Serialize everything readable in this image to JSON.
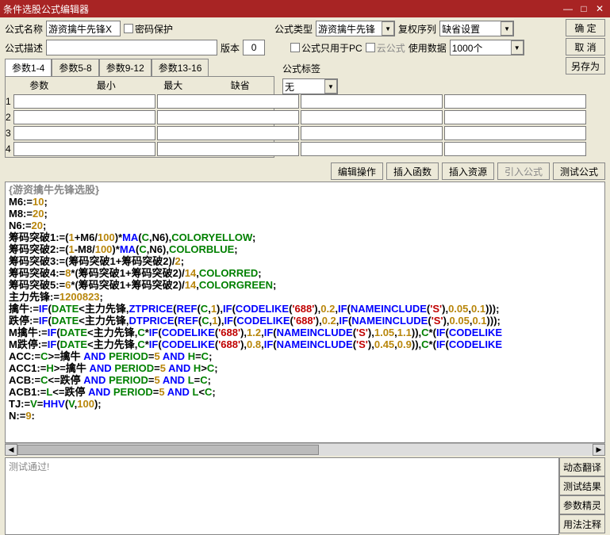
{
  "title": "条件选股公式编辑器",
  "labels": {
    "formula_name": "公式名称",
    "pwd_protect": "密码保护",
    "formula_type": "公式类型",
    "reset_seq": "复权序列",
    "formula_desc": "公式描述",
    "version": "版本",
    "pc_only": "公式只用于PC",
    "cloud_formula": "云公式",
    "use_data": "使用数据",
    "formula_tag": "公式标签",
    "ok": "确 定",
    "cancel": "取 消",
    "save_as": "另存为"
  },
  "values": {
    "formula_name": "游资擒牛先锋X",
    "formula_type": "游资擒牛先锋",
    "reset_seq": "缺省设置",
    "version": "0",
    "use_data": "1000个",
    "formula_tag": "无"
  },
  "param_tabs": [
    "参数1-4",
    "参数5-8",
    "参数9-12",
    "参数13-16"
  ],
  "param_headers": [
    "参数",
    "最小",
    "最大",
    "缺省"
  ],
  "action_buttons": {
    "edit_op": "编辑操作",
    "insert_fn": "插入函数",
    "insert_res": "插入资源",
    "import_formula": "引入公式",
    "test_formula": "测试公式"
  },
  "code_lines": [
    {
      "segs": [
        {
          "c": "gray",
          "t": "{游资擒牛先锋选股}"
        }
      ]
    },
    {
      "segs": [
        {
          "c": "black",
          "t": "M6:="
        },
        {
          "c": "brown",
          "t": "10"
        },
        {
          "c": "black",
          "t": ";"
        }
      ]
    },
    {
      "segs": [
        {
          "c": "black",
          "t": "M8:="
        },
        {
          "c": "brown",
          "t": "20"
        },
        {
          "c": "black",
          "t": ";"
        }
      ]
    },
    {
      "segs": [
        {
          "c": "black",
          "t": "N6:="
        },
        {
          "c": "brown",
          "t": "20"
        },
        {
          "c": "black",
          "t": ";"
        }
      ]
    },
    {
      "segs": [
        {
          "c": "black",
          "t": "筹码突破1:=("
        },
        {
          "c": "brown",
          "t": "1"
        },
        {
          "c": "black",
          "t": "+M6/"
        },
        {
          "c": "brown",
          "t": "100"
        },
        {
          "c": "black",
          "t": ")*"
        },
        {
          "c": "blue",
          "t": "MA"
        },
        {
          "c": "black",
          "t": "("
        },
        {
          "c": "green",
          "t": "C"
        },
        {
          "c": "black",
          "t": ",N6),"
        },
        {
          "c": "green",
          "t": "COLORYELLOW"
        },
        {
          "c": "black",
          "t": ";"
        }
      ]
    },
    {
      "segs": [
        {
          "c": "black",
          "t": "筹码突破2:=("
        },
        {
          "c": "brown",
          "t": "1"
        },
        {
          "c": "black",
          "t": "-M8/"
        },
        {
          "c": "brown",
          "t": "100"
        },
        {
          "c": "black",
          "t": ")*"
        },
        {
          "c": "blue",
          "t": "MA"
        },
        {
          "c": "black",
          "t": "("
        },
        {
          "c": "green",
          "t": "C"
        },
        {
          "c": "black",
          "t": ",N6),"
        },
        {
          "c": "green",
          "t": "COLORBLUE"
        },
        {
          "c": "black",
          "t": ";"
        }
      ]
    },
    {
      "segs": [
        {
          "c": "black",
          "t": "筹码突破3:=(筹码突破1+筹码突破2)/"
        },
        {
          "c": "brown",
          "t": "2"
        },
        {
          "c": "black",
          "t": ";"
        }
      ]
    },
    {
      "segs": [
        {
          "c": "black",
          "t": "筹码突破4:="
        },
        {
          "c": "brown",
          "t": "8"
        },
        {
          "c": "black",
          "t": "*(筹码突破1+筹码突破2)/"
        },
        {
          "c": "brown",
          "t": "14"
        },
        {
          "c": "black",
          "t": ","
        },
        {
          "c": "green",
          "t": "COLORRED"
        },
        {
          "c": "black",
          "t": ";"
        }
      ]
    },
    {
      "segs": [
        {
          "c": "black",
          "t": "筹码突破5:="
        },
        {
          "c": "brown",
          "t": "6"
        },
        {
          "c": "black",
          "t": "*(筹码突破1+筹码突破2)/"
        },
        {
          "c": "brown",
          "t": "14"
        },
        {
          "c": "black",
          "t": ","
        },
        {
          "c": "green",
          "t": "COLORGREEN"
        },
        {
          "c": "black",
          "t": ";"
        }
      ]
    },
    {
      "segs": [
        {
          "c": "black",
          "t": "主力先锋:="
        },
        {
          "c": "brown",
          "t": "1200823"
        },
        {
          "c": "black",
          "t": ";"
        }
      ]
    },
    {
      "segs": [
        {
          "c": "black",
          "t": "擒牛:="
        },
        {
          "c": "blue",
          "t": "IF"
        },
        {
          "c": "black",
          "t": "("
        },
        {
          "c": "green",
          "t": "DATE"
        },
        {
          "c": "black",
          "t": "<主力先锋,"
        },
        {
          "c": "blue",
          "t": "ZTPRICE"
        },
        {
          "c": "black",
          "t": "("
        },
        {
          "c": "blue",
          "t": "REF"
        },
        {
          "c": "black",
          "t": "("
        },
        {
          "c": "green",
          "t": "C"
        },
        {
          "c": "black",
          "t": ","
        },
        {
          "c": "brown",
          "t": "1"
        },
        {
          "c": "black",
          "t": "),"
        },
        {
          "c": "blue",
          "t": "IF"
        },
        {
          "c": "black",
          "t": "("
        },
        {
          "c": "blue",
          "t": "CODELIKE"
        },
        {
          "c": "black",
          "t": "("
        },
        {
          "c": "red",
          "t": "'688'"
        },
        {
          "c": "black",
          "t": "),"
        },
        {
          "c": "brown",
          "t": "0.2"
        },
        {
          "c": "black",
          "t": ","
        },
        {
          "c": "blue",
          "t": "IF"
        },
        {
          "c": "black",
          "t": "("
        },
        {
          "c": "blue",
          "t": "NAMEINCLUDE"
        },
        {
          "c": "black",
          "t": "("
        },
        {
          "c": "red",
          "t": "'S'"
        },
        {
          "c": "black",
          "t": "),"
        },
        {
          "c": "brown",
          "t": "0.05"
        },
        {
          "c": "black",
          "t": ","
        },
        {
          "c": "brown",
          "t": "0.1"
        },
        {
          "c": "black",
          "t": ")));"
        }
      ]
    },
    {
      "segs": [
        {
          "c": "black",
          "t": "跌停:="
        },
        {
          "c": "blue",
          "t": "IF"
        },
        {
          "c": "black",
          "t": "("
        },
        {
          "c": "green",
          "t": "DATE"
        },
        {
          "c": "black",
          "t": "<主力先锋,"
        },
        {
          "c": "blue",
          "t": "DTPRICE"
        },
        {
          "c": "black",
          "t": "("
        },
        {
          "c": "blue",
          "t": "REF"
        },
        {
          "c": "black",
          "t": "("
        },
        {
          "c": "green",
          "t": "C"
        },
        {
          "c": "black",
          "t": ","
        },
        {
          "c": "brown",
          "t": "1"
        },
        {
          "c": "black",
          "t": "),"
        },
        {
          "c": "blue",
          "t": "IF"
        },
        {
          "c": "black",
          "t": "("
        },
        {
          "c": "blue",
          "t": "CODELIKE"
        },
        {
          "c": "black",
          "t": "("
        },
        {
          "c": "red",
          "t": "'688'"
        },
        {
          "c": "black",
          "t": "),"
        },
        {
          "c": "brown",
          "t": "0.2"
        },
        {
          "c": "black",
          "t": ","
        },
        {
          "c": "blue",
          "t": "IF"
        },
        {
          "c": "black",
          "t": "("
        },
        {
          "c": "blue",
          "t": "NAMEINCLUDE"
        },
        {
          "c": "black",
          "t": "("
        },
        {
          "c": "red",
          "t": "'S'"
        },
        {
          "c": "black",
          "t": "),"
        },
        {
          "c": "brown",
          "t": "0.05"
        },
        {
          "c": "black",
          "t": ","
        },
        {
          "c": "brown",
          "t": "0.1"
        },
        {
          "c": "black",
          "t": ")));"
        }
      ]
    },
    {
      "segs": [
        {
          "c": "black",
          "t": "M擒牛:="
        },
        {
          "c": "blue",
          "t": "IF"
        },
        {
          "c": "black",
          "t": "("
        },
        {
          "c": "green",
          "t": "DATE"
        },
        {
          "c": "black",
          "t": "<主力先锋,"
        },
        {
          "c": "green",
          "t": "C"
        },
        {
          "c": "black",
          "t": "*"
        },
        {
          "c": "blue",
          "t": "IF"
        },
        {
          "c": "black",
          "t": "("
        },
        {
          "c": "blue",
          "t": "CODELIKE"
        },
        {
          "c": "black",
          "t": "("
        },
        {
          "c": "red",
          "t": "'688'"
        },
        {
          "c": "black",
          "t": "),"
        },
        {
          "c": "brown",
          "t": "1.2"
        },
        {
          "c": "black",
          "t": ","
        },
        {
          "c": "blue",
          "t": "IF"
        },
        {
          "c": "black",
          "t": "("
        },
        {
          "c": "blue",
          "t": "NAMEINCLUDE"
        },
        {
          "c": "black",
          "t": "("
        },
        {
          "c": "red",
          "t": "'S'"
        },
        {
          "c": "black",
          "t": "),"
        },
        {
          "c": "brown",
          "t": "1.05"
        },
        {
          "c": "black",
          "t": ","
        },
        {
          "c": "brown",
          "t": "1.1"
        },
        {
          "c": "black",
          "t": ")),"
        },
        {
          "c": "green",
          "t": "C"
        },
        {
          "c": "black",
          "t": "*("
        },
        {
          "c": "blue",
          "t": "IF"
        },
        {
          "c": "black",
          "t": "("
        },
        {
          "c": "blue",
          "t": "CODELIKE"
        }
      ]
    },
    {
      "segs": [
        {
          "c": "black",
          "t": "M跌停:="
        },
        {
          "c": "blue",
          "t": "IF"
        },
        {
          "c": "black",
          "t": "("
        },
        {
          "c": "green",
          "t": "DATE"
        },
        {
          "c": "black",
          "t": "<主力先锋,"
        },
        {
          "c": "green",
          "t": "C"
        },
        {
          "c": "black",
          "t": "*"
        },
        {
          "c": "blue",
          "t": "IF"
        },
        {
          "c": "black",
          "t": "("
        },
        {
          "c": "blue",
          "t": "CODELIKE"
        },
        {
          "c": "black",
          "t": "("
        },
        {
          "c": "red",
          "t": "'688'"
        },
        {
          "c": "black",
          "t": "),"
        },
        {
          "c": "brown",
          "t": "0.8"
        },
        {
          "c": "black",
          "t": ","
        },
        {
          "c": "blue",
          "t": "IF"
        },
        {
          "c": "black",
          "t": "("
        },
        {
          "c": "blue",
          "t": "NAMEINCLUDE"
        },
        {
          "c": "black",
          "t": "("
        },
        {
          "c": "red",
          "t": "'S'"
        },
        {
          "c": "black",
          "t": "),"
        },
        {
          "c": "brown",
          "t": "0.45"
        },
        {
          "c": "black",
          "t": ","
        },
        {
          "c": "brown",
          "t": "0.9"
        },
        {
          "c": "black",
          "t": ")),"
        },
        {
          "c": "green",
          "t": "C"
        },
        {
          "c": "black",
          "t": "*("
        },
        {
          "c": "blue",
          "t": "IF"
        },
        {
          "c": "black",
          "t": "("
        },
        {
          "c": "blue",
          "t": "CODELIKE"
        }
      ]
    },
    {
      "segs": [
        {
          "c": "black",
          "t": "ACC:="
        },
        {
          "c": "green",
          "t": "C"
        },
        {
          "c": "black",
          "t": ">=擒牛 "
        },
        {
          "c": "blue",
          "t": "AND"
        },
        {
          "c": "black",
          "t": " "
        },
        {
          "c": "green",
          "t": "PERIOD"
        },
        {
          "c": "black",
          "t": "="
        },
        {
          "c": "brown",
          "t": "5"
        },
        {
          "c": "black",
          "t": " "
        },
        {
          "c": "blue",
          "t": "AND"
        },
        {
          "c": "black",
          "t": " "
        },
        {
          "c": "green",
          "t": "H"
        },
        {
          "c": "black",
          "t": "="
        },
        {
          "c": "green",
          "t": "C"
        },
        {
          "c": "black",
          "t": ";"
        }
      ]
    },
    {
      "segs": [
        {
          "c": "black",
          "t": "ACC1:="
        },
        {
          "c": "green",
          "t": "H"
        },
        {
          "c": "black",
          "t": ">=擒牛 "
        },
        {
          "c": "blue",
          "t": "AND"
        },
        {
          "c": "black",
          "t": " "
        },
        {
          "c": "green",
          "t": "PERIOD"
        },
        {
          "c": "black",
          "t": "="
        },
        {
          "c": "brown",
          "t": "5"
        },
        {
          "c": "black",
          "t": " "
        },
        {
          "c": "blue",
          "t": "AND"
        },
        {
          "c": "black",
          "t": " "
        },
        {
          "c": "green",
          "t": "H"
        },
        {
          "c": "black",
          "t": ">"
        },
        {
          "c": "green",
          "t": "C"
        },
        {
          "c": "black",
          "t": ";"
        }
      ]
    },
    {
      "segs": [
        {
          "c": "black",
          "t": "ACB:="
        },
        {
          "c": "green",
          "t": "C"
        },
        {
          "c": "black",
          "t": "<=跌停 "
        },
        {
          "c": "blue",
          "t": "AND"
        },
        {
          "c": "black",
          "t": " "
        },
        {
          "c": "green",
          "t": "PERIOD"
        },
        {
          "c": "black",
          "t": "="
        },
        {
          "c": "brown",
          "t": "5"
        },
        {
          "c": "black",
          "t": " "
        },
        {
          "c": "blue",
          "t": "AND"
        },
        {
          "c": "black",
          "t": " "
        },
        {
          "c": "green",
          "t": "L"
        },
        {
          "c": "black",
          "t": "="
        },
        {
          "c": "green",
          "t": "C"
        },
        {
          "c": "black",
          "t": ";"
        }
      ]
    },
    {
      "segs": [
        {
          "c": "black",
          "t": "ACB1:="
        },
        {
          "c": "green",
          "t": "L"
        },
        {
          "c": "black",
          "t": "<=跌停 "
        },
        {
          "c": "blue",
          "t": "AND"
        },
        {
          "c": "black",
          "t": " "
        },
        {
          "c": "green",
          "t": "PERIOD"
        },
        {
          "c": "black",
          "t": "="
        },
        {
          "c": "brown",
          "t": "5"
        },
        {
          "c": "black",
          "t": " "
        },
        {
          "c": "blue",
          "t": "AND"
        },
        {
          "c": "black",
          "t": " "
        },
        {
          "c": "green",
          "t": "L"
        },
        {
          "c": "black",
          "t": "<"
        },
        {
          "c": "green",
          "t": "C"
        },
        {
          "c": "black",
          "t": ";"
        }
      ]
    },
    {
      "segs": [
        {
          "c": "black",
          "t": "TJ:="
        },
        {
          "c": "green",
          "t": "V"
        },
        {
          "c": "black",
          "t": "="
        },
        {
          "c": "blue",
          "t": "HHV"
        },
        {
          "c": "black",
          "t": "("
        },
        {
          "c": "green",
          "t": "V"
        },
        {
          "c": "black",
          "t": ","
        },
        {
          "c": "brown",
          "t": "100"
        },
        {
          "c": "black",
          "t": ");"
        }
      ]
    },
    {
      "segs": [
        {
          "c": "black",
          "t": "N:="
        },
        {
          "c": "brown",
          "t": "9"
        },
        {
          "c": "black",
          "t": ":"
        }
      ]
    }
  ],
  "output_text": "测试通过!",
  "side_buttons": [
    "动态翻译",
    "测试结果",
    "参数精灵",
    "用法注释"
  ]
}
